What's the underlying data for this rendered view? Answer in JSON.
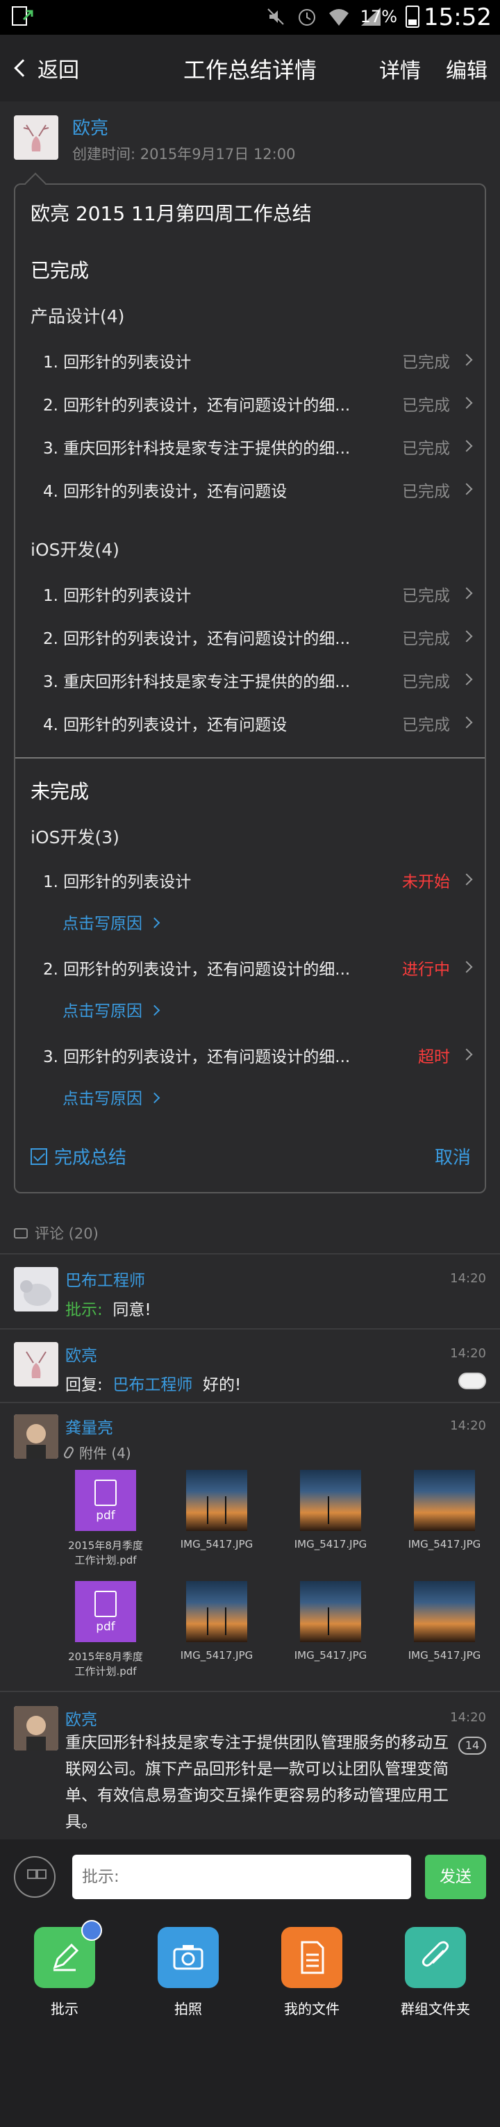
{
  "status_bar": {
    "battery_percent": "17%",
    "time": "15:52"
  },
  "nav": {
    "back_label": "返回",
    "title": "工作总结详情",
    "detail_label": "详情",
    "edit_label": "编辑"
  },
  "author": {
    "name": "欧亮",
    "created": "创建时间: 2015年9月17日 12:00"
  },
  "summary": {
    "title": "欧亮 2015 11月第四周工作总结",
    "done_section": "已完成",
    "groups_done": [
      {
        "title": "产品设计(4)",
        "items": [
          {
            "text": "1. 回形针的列表设计",
            "status": "已完成"
          },
          {
            "text": "2. 回形针的列表设计，还有问题设计的细...",
            "status": "已完成"
          },
          {
            "text": "3. 重庆回形针科技是家专注于提供的的细...",
            "status": "已完成"
          },
          {
            "text": "4. 回形针的列表设计，还有问题设",
            "status": "已完成"
          }
        ]
      },
      {
        "title": "iOS开发(4)",
        "items": [
          {
            "text": "1. 回形针的列表设计",
            "status": "已完成"
          },
          {
            "text": "2. 回形针的列表设计，还有问题设计的细...",
            "status": "已完成"
          },
          {
            "text": "3. 重庆回形针科技是家专注于提供的的细...",
            "status": "已完成"
          },
          {
            "text": "4. 回形针的列表设计，还有问题设",
            "status": "已完成"
          }
        ]
      }
    ],
    "undone_section": "未完成",
    "undone_group_title": "iOS开发(3)",
    "undone_items": [
      {
        "text": "1. 回形针的列表设计",
        "status": "未开始",
        "reason": "点击写原因"
      },
      {
        "text": "2. 回形针的列表设计，还有问题设计的细...",
        "status": "进行中",
        "reason": "点击写原因"
      },
      {
        "text": "3. 回形针的列表设计，还有问题设计的细...",
        "status": "超时",
        "reason": "点击写原因"
      }
    ],
    "complete_label": "完成总结",
    "cancel_label": "取消"
  },
  "comments": {
    "header": "评论 (20)",
    "items": [
      {
        "name": "巴布工程师",
        "time": "14:20",
        "prefix": "批示:",
        "text": "同意!"
      },
      {
        "name": "欧亮",
        "time": "14:20",
        "prefix": "回复:",
        "mention": "巴布工程师",
        "text": "好的!"
      },
      {
        "name": "龚量亮",
        "time": "14:20",
        "attachments_label": "附件 (4)"
      },
      {
        "name": "欧亮",
        "time": "14:20",
        "badge": "14",
        "text": "重庆回形针科技是家专注于提供团队管理服务的移动互联网公司。旗下产品回形针是一款可以让团队管理变简单、有效信息易查询交互操作更容易的移动管理应用工具。"
      }
    ],
    "attachments": [
      {
        "type": "pdf",
        "label": "pdf",
        "name": "2015年8月季度工作计划.pdf"
      },
      {
        "type": "img",
        "name": "IMG_5417.JPG"
      },
      {
        "type": "img",
        "name": "IMG_5417.JPG"
      },
      {
        "type": "img",
        "name": "IMG_5417.JPG"
      },
      {
        "type": "pdf",
        "label": "pdf",
        "name": "2015年8月季度工作计划.pdf"
      },
      {
        "type": "img",
        "name": "IMG_5417.JPG"
      },
      {
        "type": "img",
        "name": "IMG_5417.JPG"
      },
      {
        "type": "img",
        "name": "IMG_5417.JPG"
      }
    ]
  },
  "input": {
    "placeholder": "批示:",
    "send_label": "发送"
  },
  "quick_actions": [
    {
      "label": "批示",
      "icon": "pen-icon",
      "color": "#4ac461"
    },
    {
      "label": "拍照",
      "icon": "camera-icon",
      "color": "#3a9be0"
    },
    {
      "label": "我的文件",
      "icon": "document-icon",
      "color": "#f07a2a"
    },
    {
      "label": "群组文件夹",
      "icon": "paperclip-icon",
      "color": "#3ab8a0"
    }
  ]
}
